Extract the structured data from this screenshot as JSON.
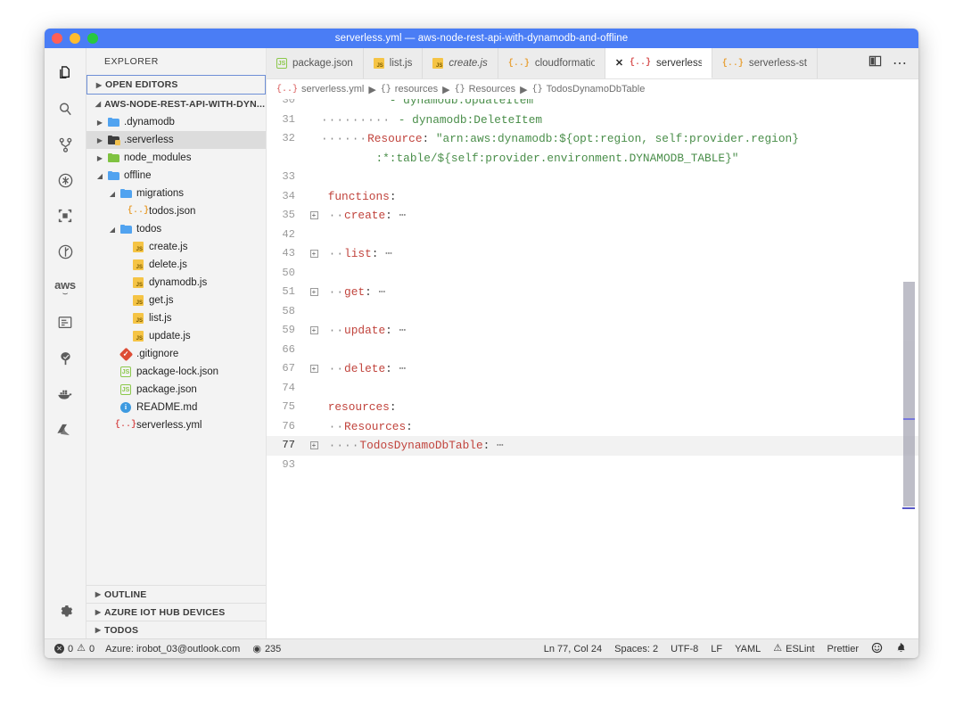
{
  "window": {
    "title": "serverless.yml — aws-node-rest-api-with-dynamodb-and-offline",
    "traffic": [
      "close-red",
      "minimize-yellow",
      "maximize-green"
    ]
  },
  "activitybar": {
    "items": [
      {
        "name": "explorer",
        "icon": "files-icon",
        "active": true
      },
      {
        "name": "search",
        "icon": "search-icon",
        "active": false
      },
      {
        "name": "source-control",
        "icon": "source-control-icon",
        "active": false
      },
      {
        "name": "run-debug",
        "icon": "debug-icon",
        "active": false
      },
      {
        "name": "extensions",
        "icon": "extensions-icon",
        "active": false
      },
      {
        "name": "test-explorer",
        "icon": "beaker-icon",
        "active": false
      },
      {
        "name": "aws-explorer",
        "icon": "aws-icon",
        "active": false
      },
      {
        "name": "remote-explorer",
        "icon": "remote-icon",
        "active": false
      },
      {
        "name": "azure",
        "icon": "azure-tree-icon",
        "active": false
      },
      {
        "name": "docker",
        "icon": "docker-icon",
        "active": false
      },
      {
        "name": "azure-account",
        "icon": "azure-logo-icon",
        "active": false
      }
    ],
    "settings": {
      "name": "manage-settings",
      "icon": "gear-icon"
    }
  },
  "sidebar": {
    "title": "EXPLORER",
    "open_editors_label": "OPEN EDITORS",
    "project_label": "AWS-NODE-REST-API-WITH-DYN...",
    "tree": [
      {
        "label": ".dynamodb",
        "indent": 1,
        "type": "folder",
        "expanded": false,
        "selected": false
      },
      {
        "label": ".serverless",
        "indent": 1,
        "type": "folder-dark",
        "expanded": false,
        "selected": true
      },
      {
        "label": "node_modules",
        "indent": 1,
        "type": "folder-green",
        "expanded": false,
        "selected": false
      },
      {
        "label": "offline",
        "indent": 1,
        "type": "folder",
        "expanded": true,
        "selected": false
      },
      {
        "label": "migrations",
        "indent": 2,
        "type": "folder",
        "expanded": true,
        "selected": false
      },
      {
        "label": "todos.json",
        "indent": 3,
        "type": "json",
        "selected": false
      },
      {
        "label": "todos",
        "indent": 2,
        "type": "folder",
        "expanded": true,
        "selected": false
      },
      {
        "label": "create.js",
        "indent": 3,
        "type": "js",
        "selected": false
      },
      {
        "label": "delete.js",
        "indent": 3,
        "type": "js",
        "selected": false
      },
      {
        "label": "dynamodb.js",
        "indent": 3,
        "type": "js",
        "selected": false
      },
      {
        "label": "get.js",
        "indent": 3,
        "type": "js",
        "selected": false
      },
      {
        "label": "list.js",
        "indent": 3,
        "type": "js",
        "selected": false
      },
      {
        "label": "update.js",
        "indent": 3,
        "type": "js",
        "selected": false
      },
      {
        "label": ".gitignore",
        "indent": 2,
        "type": "git",
        "selected": false
      },
      {
        "label": "package-lock.json",
        "indent": 2,
        "type": "npm",
        "selected": false
      },
      {
        "label": "package.json",
        "indent": 2,
        "type": "npm",
        "selected": false
      },
      {
        "label": "README.md",
        "indent": 2,
        "type": "md",
        "selected": false
      },
      {
        "label": "serverless.yml",
        "indent": 2,
        "type": "yml",
        "selected": false
      }
    ],
    "bottom_sections": [
      {
        "label": "OUTLINE"
      },
      {
        "label": "AZURE IOT HUB DEVICES"
      },
      {
        "label": "TODOS"
      }
    ]
  },
  "tabs": [
    {
      "label": "package.json",
      "icon": "npm-icon",
      "active": false,
      "italic": false,
      "dirty": false
    },
    {
      "label": "list.js",
      "icon": "js-icon",
      "active": false,
      "italic": false,
      "dirty": false
    },
    {
      "label": "create.js",
      "icon": "js-icon",
      "active": false,
      "italic": true,
      "dirty": false
    },
    {
      "label": "cloudformatio",
      "icon": "json-icon",
      "active": false,
      "italic": false,
      "dirty": false
    },
    {
      "label": "serverless.ym",
      "icon": "yml-icon",
      "active": true,
      "italic": false,
      "dirty": false,
      "close": "✕"
    },
    {
      "label": "serverless-st",
      "icon": "json-icon",
      "active": false,
      "italic": false,
      "dirty": false
    }
  ],
  "tab_actions": [
    {
      "name": "split-editor",
      "icon": "split-editor-icon"
    },
    {
      "name": "more-actions",
      "icon": "ellipsis-icon",
      "glyph": "⋯"
    }
  ],
  "breadcrumbs": [
    {
      "sym": "{..}",
      "label": "serverless.yml"
    },
    {
      "sym": "{}",
      "label": "resources"
    },
    {
      "sym": "{}",
      "label": "Resources"
    },
    {
      "sym": "{}",
      "label": "TodosDynamoDbTable"
    }
  ],
  "editor": {
    "lines": [
      {
        "no": "30",
        "fold": false,
        "cur": false,
        "tall": false,
        "segments": [
          {
            "t": "          ",
            "c": "ws"
          },
          {
            "t": "- dynamodb:UpdateItem",
            "c": "str"
          }
        ]
      },
      {
        "no": "31",
        "fold": false,
        "cur": false,
        "tall": false,
        "segments": [
          {
            "t": "········· ",
            "c": "dots"
          },
          {
            "t": "- dynamodb:DeleteItem",
            "c": "str"
          }
        ]
      },
      {
        "no": "32",
        "fold": false,
        "cur": false,
        "tall": true,
        "segments": [
          {
            "t": "······",
            "c": "dots"
          },
          {
            "t": "Resource",
            "c": "key"
          },
          {
            "t": ": ",
            "c": "punc"
          },
          {
            "t": "\"arn:aws:dynamodb:${opt:region, self:provider.region}",
            "c": "str"
          }
        ],
        "segments2": [
          {
            "t": "        ",
            "c": "ws"
          },
          {
            "t": ":*:table/${self:provider.environment.DYNAMODB_TABLE}\"",
            "c": "str"
          }
        ]
      },
      {
        "no": "33",
        "fold": false,
        "cur": false,
        "tall": false,
        "segments": []
      },
      {
        "no": "34",
        "fold": false,
        "cur": false,
        "tall": false,
        "segments": [
          {
            "t": " ",
            "c": "ws"
          },
          {
            "t": "functions",
            "c": "key"
          },
          {
            "t": ":",
            "c": "punc"
          }
        ]
      },
      {
        "no": "35",
        "fold": true,
        "cur": false,
        "tall": false,
        "segments": [
          {
            "t": " ··",
            "c": "dots"
          },
          {
            "t": "create",
            "c": "key"
          },
          {
            "t": ": ",
            "c": "punc"
          },
          {
            "t": "⋯",
            "c": "dots"
          }
        ]
      },
      {
        "no": "42",
        "fold": false,
        "cur": false,
        "tall": false,
        "segments": []
      },
      {
        "no": "43",
        "fold": true,
        "cur": false,
        "tall": false,
        "segments": [
          {
            "t": " ··",
            "c": "dots"
          },
          {
            "t": "list",
            "c": "key"
          },
          {
            "t": ": ",
            "c": "punc"
          },
          {
            "t": "⋯",
            "c": "dots"
          }
        ]
      },
      {
        "no": "50",
        "fold": false,
        "cur": false,
        "tall": false,
        "segments": []
      },
      {
        "no": "51",
        "fold": true,
        "cur": false,
        "tall": false,
        "segments": [
          {
            "t": " ··",
            "c": "dots"
          },
          {
            "t": "get",
            "c": "key"
          },
          {
            "t": ": ",
            "c": "punc"
          },
          {
            "t": "⋯",
            "c": "dots"
          }
        ]
      },
      {
        "no": "58",
        "fold": false,
        "cur": false,
        "tall": false,
        "segments": []
      },
      {
        "no": "59",
        "fold": true,
        "cur": false,
        "tall": false,
        "segments": [
          {
            "t": " ··",
            "c": "dots"
          },
          {
            "t": "update",
            "c": "key"
          },
          {
            "t": ": ",
            "c": "punc"
          },
          {
            "t": "⋯",
            "c": "dots"
          }
        ]
      },
      {
        "no": "66",
        "fold": false,
        "cur": false,
        "tall": false,
        "segments": []
      },
      {
        "no": "67",
        "fold": true,
        "cur": false,
        "tall": false,
        "segments": [
          {
            "t": " ··",
            "c": "dots"
          },
          {
            "t": "delete",
            "c": "key"
          },
          {
            "t": ": ",
            "c": "punc"
          },
          {
            "t": "⋯",
            "c": "dots"
          }
        ]
      },
      {
        "no": "74",
        "fold": false,
        "cur": false,
        "tall": false,
        "segments": []
      },
      {
        "no": "75",
        "fold": false,
        "cur": false,
        "tall": false,
        "segments": [
          {
            "t": " ",
            "c": "ws"
          },
          {
            "t": "resources",
            "c": "key"
          },
          {
            "t": ":",
            "c": "punc"
          }
        ]
      },
      {
        "no": "76",
        "fold": false,
        "cur": false,
        "tall": false,
        "segments": [
          {
            "t": " ··",
            "c": "dots"
          },
          {
            "t": "Resources",
            "c": "key"
          },
          {
            "t": ":",
            "c": "punc"
          }
        ]
      },
      {
        "no": "77",
        "fold": true,
        "cur": true,
        "tall": false,
        "segments": [
          {
            "t": " ····",
            "c": "dots"
          },
          {
            "t": "TodosDynamoDbTable",
            "c": "key"
          },
          {
            "t": ": ",
            "c": "punc"
          },
          {
            "t": "⋯",
            "c": "dots"
          }
        ]
      },
      {
        "no": "93",
        "fold": false,
        "cur": false,
        "tall": false,
        "segments": []
      }
    ]
  },
  "statusbar": {
    "errors": "0",
    "warnings": "0",
    "azure": "Azure: irobot_03@outlook.com",
    "watchers": "235",
    "cursor": "Ln 77, Col 24",
    "spaces": "Spaces: 2",
    "encoding": "UTF-8",
    "eol": "LF",
    "language": "YAML",
    "eslint": "ESLint",
    "prettier": "Prettier",
    "feedback_icon": "smiley-icon",
    "bell_icon": "bell-icon"
  },
  "colors": {
    "titlebar": "#4a7df5",
    "accent": "#4a7df5",
    "key": "#c1443d",
    "string": "#4a8e4a",
    "selection": "#e4e6f1"
  }
}
